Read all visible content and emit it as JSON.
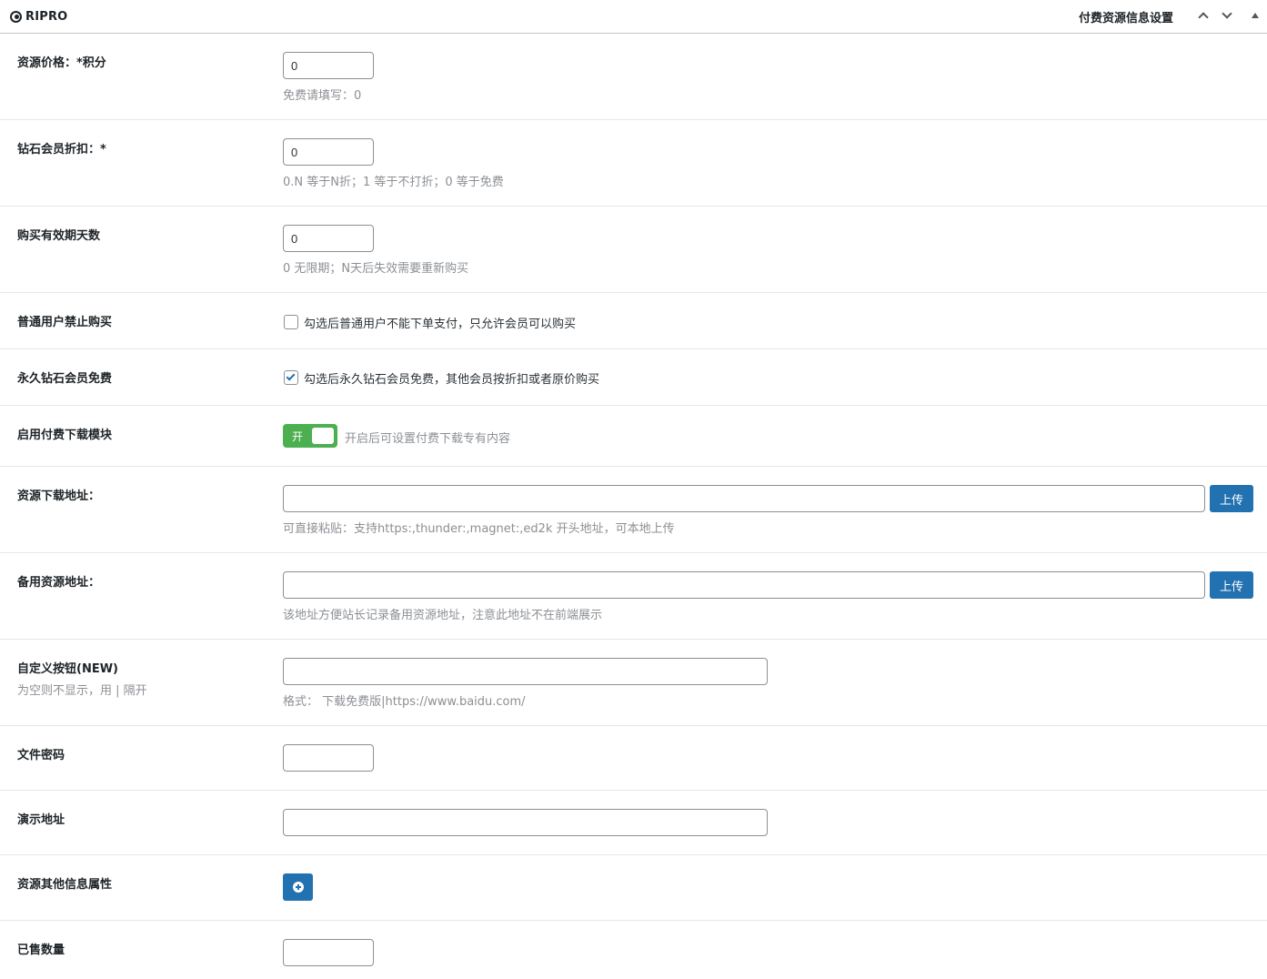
{
  "header": {
    "brand": "RIPRO",
    "title": "付费资源信息设置"
  },
  "fields": {
    "price": {
      "label": "资源价格：*积分",
      "value": "0",
      "desc": "免费请填写：0"
    },
    "diamond_discount": {
      "label": "钻石会员折扣：*",
      "value": "0",
      "desc": "0.N 等于N折；1 等于不打折；0 等于免费"
    },
    "valid_days": {
      "label": "购买有效期天数",
      "value": "0",
      "desc": "0 无限期；N天后失效需要重新购买"
    },
    "no_normal_buy": {
      "label": "普通用户禁止购买",
      "checked": false,
      "text": "勾选后普通用户不能下单支付，只允许会员可以购买"
    },
    "permanent_free": {
      "label": "永久钻石会员免费",
      "checked": true,
      "text": "勾选后永久钻石会员免费，其他会员按折扣或者原价购买"
    },
    "enable_module": {
      "label": "启用付费下载模块",
      "toggle_text": "开",
      "on": true,
      "desc": "开启后可设置付费下载专有内容"
    },
    "download_url": {
      "label": "资源下载地址：",
      "value": "",
      "upload": "上传",
      "desc": "可直接粘贴：支持https:,thunder:,magnet:,ed2k 开头地址，可本地上传"
    },
    "backup_url": {
      "label": "备用资源地址：",
      "value": "",
      "upload": "上传",
      "desc": "该地址方便站长记录备用资源地址，注意此地址不在前端展示"
    },
    "custom_button": {
      "label": "自定义按钮(NEW)",
      "sublabel": "为空则不显示，用 | 隔开",
      "value": "",
      "desc": "格式：  下载免费版|https://www.baidu.com/"
    },
    "file_password": {
      "label": "文件密码",
      "value": ""
    },
    "demo_url": {
      "label": "演示地址",
      "value": ""
    },
    "other_attrs": {
      "label": "资源其他信息属性"
    },
    "sold_count": {
      "label": "已售数量",
      "value": ""
    }
  },
  "colors": {
    "primary": "#2271b1",
    "toggle_on": "#4caf50",
    "muted_text": "#8c8f94"
  },
  "icons": [
    "ripro-logo-icon",
    "chevron-up-icon",
    "chevron-down-icon",
    "collapse-triangle-icon",
    "plus-circle-icon"
  ]
}
